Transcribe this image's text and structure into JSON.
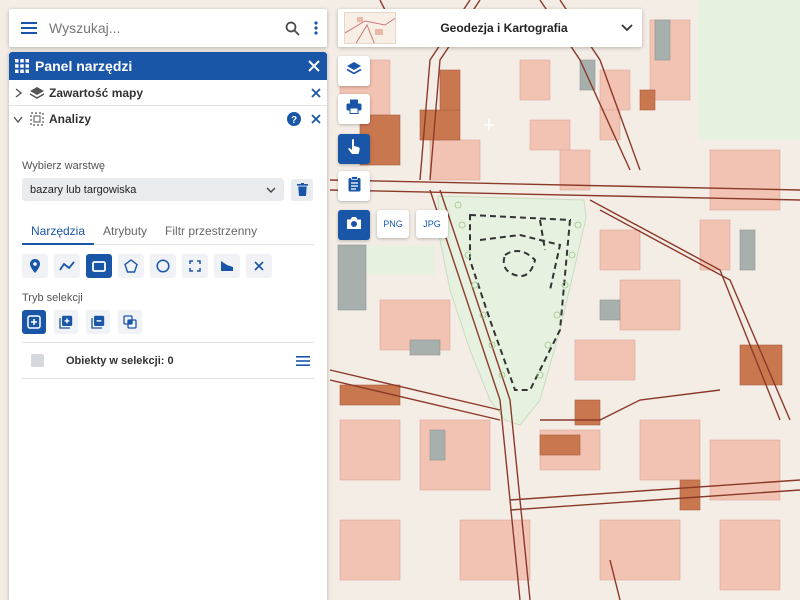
{
  "search": {
    "placeholder": "Wyszukaj..."
  },
  "panel": {
    "title": "Panel narzędzi",
    "sections": [
      {
        "label": "Zawartość mapy",
        "expanded": false,
        "icon": "layers-icon"
      },
      {
        "label": "Analizy",
        "expanded": true,
        "icon": "selection-icon"
      }
    ],
    "analysis": {
      "layer_label": "Wybierz warstwę",
      "layer_value": "bazary lub targowiska",
      "tabs": [
        {
          "label": "Narzędzia",
          "active": true
        },
        {
          "label": "Atrybuty",
          "active": false
        },
        {
          "label": "Filtr przestrzenny",
          "active": false
        }
      ],
      "draw_tools": [
        "point-icon",
        "polyline-icon",
        "rectangle-icon",
        "polygon-icon",
        "circle-icon",
        "extent-icon",
        "buffer-icon",
        "clear-icon"
      ],
      "active_draw_tool": "rectangle-icon",
      "selection_mode_label": "Tryb selekcji",
      "selection_modes": [
        "new-selection-icon",
        "add-selection-icon",
        "remove-selection-icon",
        "intersect-selection-icon"
      ],
      "active_selection_mode": "new-selection-icon",
      "objects_label": "Obiekty w selekcji: 0"
    }
  },
  "map": {
    "title": "Geodezja i Kartografia",
    "export_png": "PNG",
    "export_jpg": "JPG",
    "tools": [
      "layers-icon",
      "print-icon",
      "touch-icon",
      "clipboard-icon",
      "camera-icon"
    ],
    "active_tools": [
      "touch-icon",
      "camera-icon"
    ]
  },
  "colors": {
    "accent": "#1a56a8",
    "building": "#f2c2b2",
    "building_dark": "#c9774f",
    "building_grey": "#a8b0ad",
    "road": "#8b3a2a",
    "park": "#e6f2df"
  }
}
